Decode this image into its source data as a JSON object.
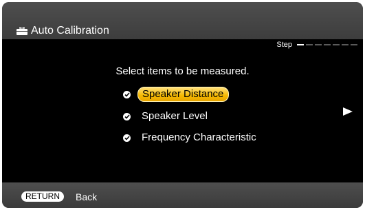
{
  "header": {
    "title": "Auto Calibration",
    "icon": "toolbox-icon"
  },
  "step": {
    "label": "Step",
    "total": 7,
    "current": 1
  },
  "main": {
    "instruction": "Select items to be measured.",
    "items": [
      {
        "label": "Speaker Distance",
        "checked": true,
        "selected": true
      },
      {
        "label": "Speaker Level",
        "checked": true,
        "selected": false
      },
      {
        "label": "Frequency Characteristic",
        "checked": true,
        "selected": false
      }
    ]
  },
  "footer": {
    "return_label": "RETURN",
    "back_label": "Back"
  },
  "colors": {
    "highlight": "#f5b800",
    "panel": "#454545",
    "background": "#000000"
  }
}
